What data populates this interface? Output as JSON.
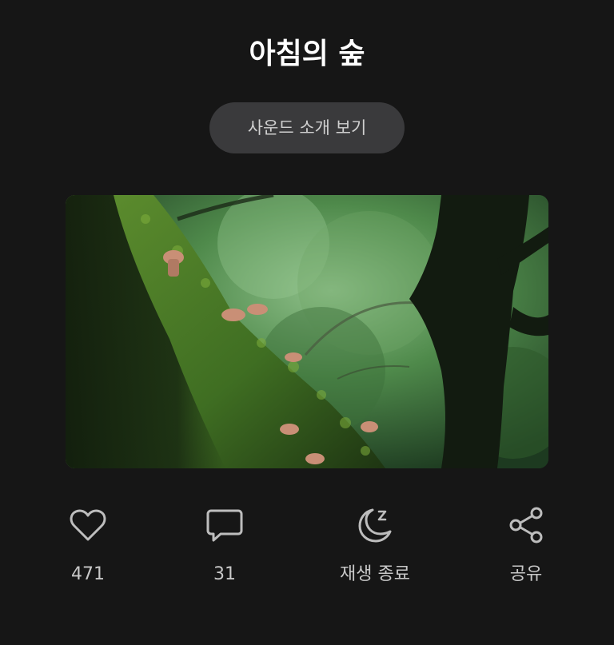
{
  "page": {
    "title": "아침의 숲"
  },
  "intro_button": {
    "label": "사운드 소개 보기"
  },
  "cover_image": {
    "icon": "forest-mushroom-photo"
  },
  "actions": [
    {
      "name": "like",
      "icon": "heart-icon",
      "label": "471"
    },
    {
      "name": "comment",
      "icon": "comment-icon",
      "label": "31"
    },
    {
      "name": "sleep-timer",
      "icon": "moon-sleep-icon",
      "label": "재생 종료"
    },
    {
      "name": "share",
      "icon": "share-icon",
      "label": "공유"
    }
  ],
  "colors": {
    "background": "#161616",
    "button_bg": "#3a3a3c",
    "icon_stroke": "#bdbdbd"
  }
}
